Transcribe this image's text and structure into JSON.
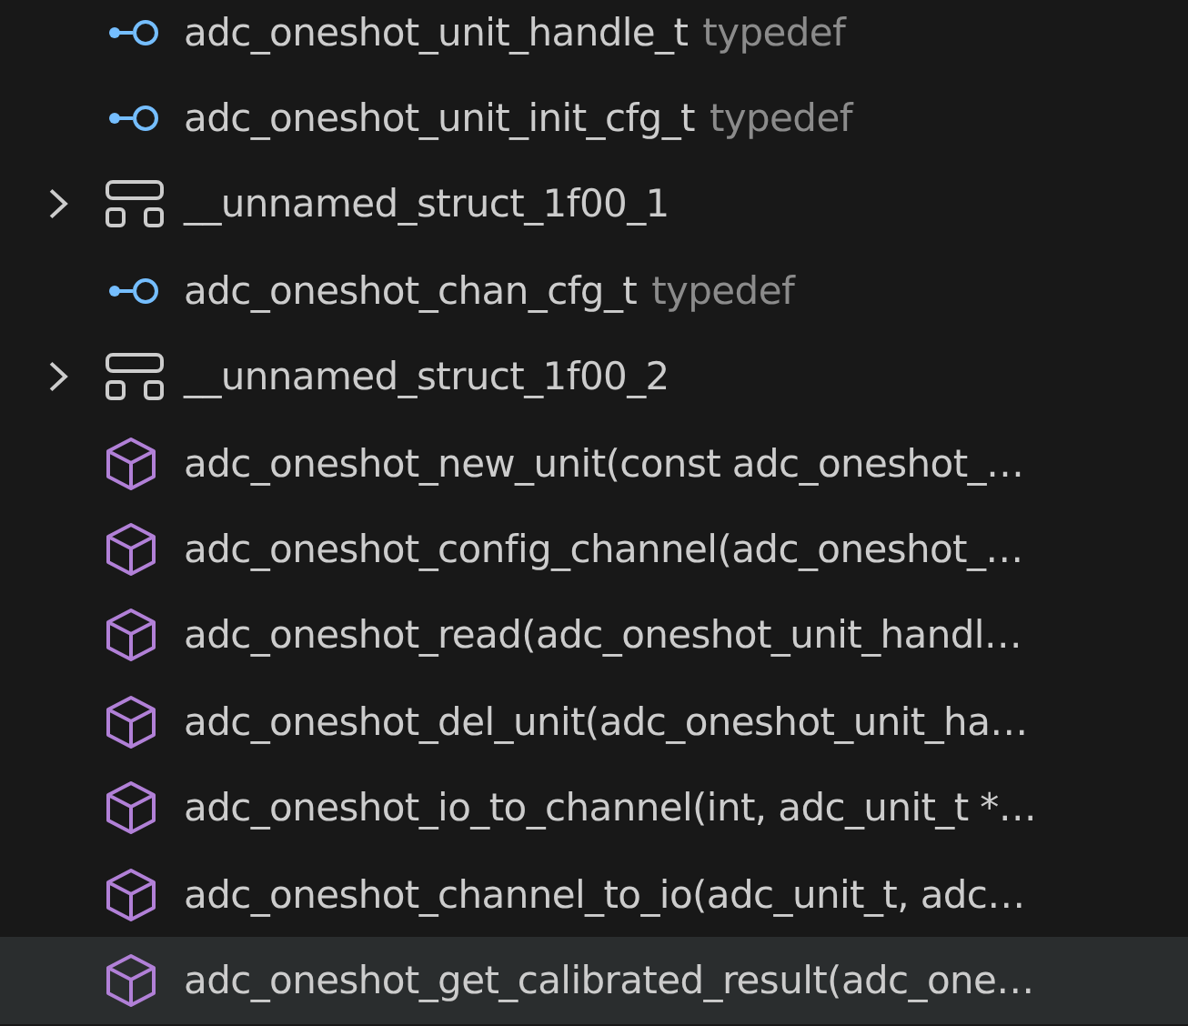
{
  "outline": {
    "items": [
      {
        "kind": "typedef",
        "label": "adc_oneshot_unit_handle_t",
        "detail": "typedef",
        "selected": false
      },
      {
        "kind": "typedef",
        "label": "adc_oneshot_unit_init_cfg_t",
        "detail": "typedef",
        "selected": false
      },
      {
        "kind": "struct",
        "label": "__unnamed_struct_1f00_1",
        "expanded": false,
        "selected": false
      },
      {
        "kind": "typedef",
        "label": "adc_oneshot_chan_cfg_t",
        "detail": "typedef",
        "selected": false
      },
      {
        "kind": "struct",
        "label": "__unnamed_struct_1f00_2",
        "expanded": false,
        "selected": false
      },
      {
        "kind": "function",
        "label": "adc_oneshot_new_unit(const adc_oneshot_…",
        "selected": false
      },
      {
        "kind": "function",
        "label": "adc_oneshot_config_channel(adc_oneshot_…",
        "selected": false
      },
      {
        "kind": "function",
        "label": "adc_oneshot_read(adc_oneshot_unit_handl…",
        "selected": false
      },
      {
        "kind": "function",
        "label": "adc_oneshot_del_unit(adc_oneshot_unit_ha…",
        "selected": false
      },
      {
        "kind": "function",
        "label": "adc_oneshot_io_to_channel(int, adc_unit_t *…",
        "selected": false
      },
      {
        "kind": "function",
        "label": "adc_oneshot_channel_to_io(adc_unit_t, adc…",
        "selected": false
      },
      {
        "kind": "function",
        "label": "adc_oneshot_get_calibrated_result(adc_one…",
        "selected": true
      }
    ]
  }
}
